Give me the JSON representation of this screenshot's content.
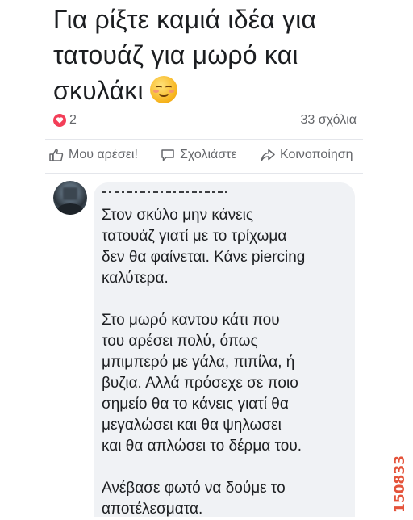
{
  "post": {
    "text_lines": [
      "Για ρίξτε καμιά ιδέα για",
      "τατουάζ για μωρό και",
      "σκυλάκι"
    ],
    "emoji_icon": "smiling-face-with-blush-icon"
  },
  "stats": {
    "reactions": "2",
    "reaction_icon": "heart-icon",
    "reaction_color": "#f33e58",
    "comments": "33 σχόλια"
  },
  "actions": {
    "like": "Μου αρέσει!",
    "comment": "Σχολιάστε",
    "share": "Κοινοποίηση"
  },
  "comment": {
    "paragraph1": [
      "Στον σκύλο μην κάνεις",
      "τατουάζ γιατί με το τρίχωμα",
      "δεν θα φαίνεται. Κάνε piercing",
      "καλύτερα."
    ],
    "paragraph2": [
      "Στο μωρό καντου κάτι που",
      "του αρέσει πολύ, όπως",
      "μπιμπερό με γάλα, πιπίλα, ή",
      "βυζια. Αλλά πρόσεχε σε ποιο",
      "σημείο θα το κάνεις γιατί θα",
      "μεγαλώσει και θα ψηλωσει",
      "και θα απλώσει το δέρμα του."
    ],
    "paragraph3": [
      "Ανέβασε φωτό να δούμε το",
      "αποτέλεσματα."
    ]
  },
  "watermark": "150833"
}
